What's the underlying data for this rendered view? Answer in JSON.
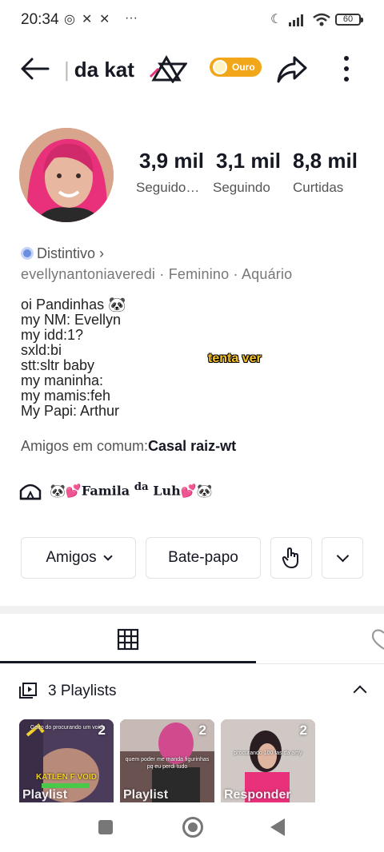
{
  "status_bar": {
    "time": "20:34",
    "battery": "60"
  },
  "header": {
    "title": "da kat",
    "badge": "Ouro"
  },
  "stats": [
    {
      "value": "3,9 mil",
      "label": "Seguido…"
    },
    {
      "value": "3,1 mil",
      "label": "Seguindo"
    },
    {
      "value": "8,8 mil",
      "label": "Curtidas"
    }
  ],
  "profile": {
    "badge_link": "Distintivo",
    "meta_line": "evellynantoniaveredi · Feminino · Aquário",
    "bio": [
      "oi Pandinhas 🐼",
      "my NM: Evellyn",
      "my idd:1?",
      "sxld:bi",
      "stt:sltr baby",
      "my maninha:",
      "my mamis:feh",
      "My Papi: Arthur"
    ],
    "overlay_caption": "tenta ver",
    "mutual_label": "Amigos em comum:",
    "mutual_value": "Casal raiz-wt",
    "family_pre": "🐼💕Famila ",
    "family_sup": "da",
    "family_post": " Luh💕🐼"
  },
  "actions": {
    "friends": "Amigos",
    "chat": "Bate-papo"
  },
  "playlists": {
    "title": "3 Playlists",
    "items": [
      {
        "count": "2",
        "caption_top": "Geito do procurando um void",
        "caption_mid": "KATLEN F VOID",
        "overlay": "Playlist",
        "bg": "#5d4a6e"
      },
      {
        "count": "2",
        "caption_top": "quem poder me manda figurinhas pq eu perdi tudo",
        "caption_mid": "",
        "overlay": "Playlist",
        "bg": "#7a5a62"
      },
      {
        "count": "2",
        "caption_top": "procurando 100 fas da amy",
        "caption_mid": "",
        "overlay": "Responder",
        "bg": "#c45a8e"
      }
    ]
  },
  "colors": {
    "text_primary": "#161823",
    "badge_gold": "#f2a61a",
    "hair_pink": "#e8317a"
  }
}
